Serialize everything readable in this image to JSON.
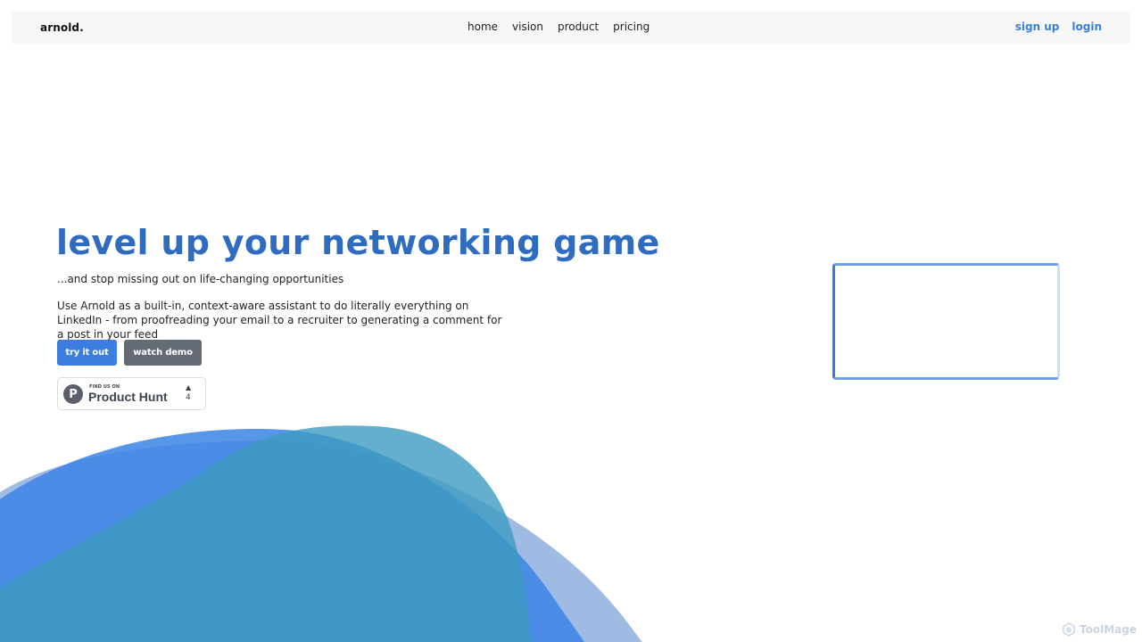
{
  "nav": {
    "brand": "arnold.",
    "links": [
      "home",
      "vision",
      "product",
      "pricing"
    ],
    "signup": "sign up",
    "login": "login"
  },
  "hero": {
    "title": "level up your networking game",
    "subtitle": "...and stop missing out on life-changing opportunities",
    "description": "Use Arnold as a built-in, context-aware assistant to do literally everything on LinkedIn - from proofreading your email to a recruiter to generating a comment for a post in your feed",
    "primary_button": "try it out",
    "secondary_button": "watch demo"
  },
  "product_hunt": {
    "logo_letter": "P",
    "small_text": "FIND US ON",
    "name": "Product Hunt",
    "upvote_icon": "triangle-up-icon",
    "upvotes": "4"
  },
  "watermark": {
    "text": "ToolMage",
    "icon": "toolmage-logo-icon"
  },
  "colors": {
    "accent": "#3b7ee0",
    "title": "#2f6cc0",
    "secondary_button": "#646b75",
    "blob_blue": "#3b84e6",
    "blob_teal": "#3d9bc0",
    "blob_light": "#95b4e0"
  }
}
